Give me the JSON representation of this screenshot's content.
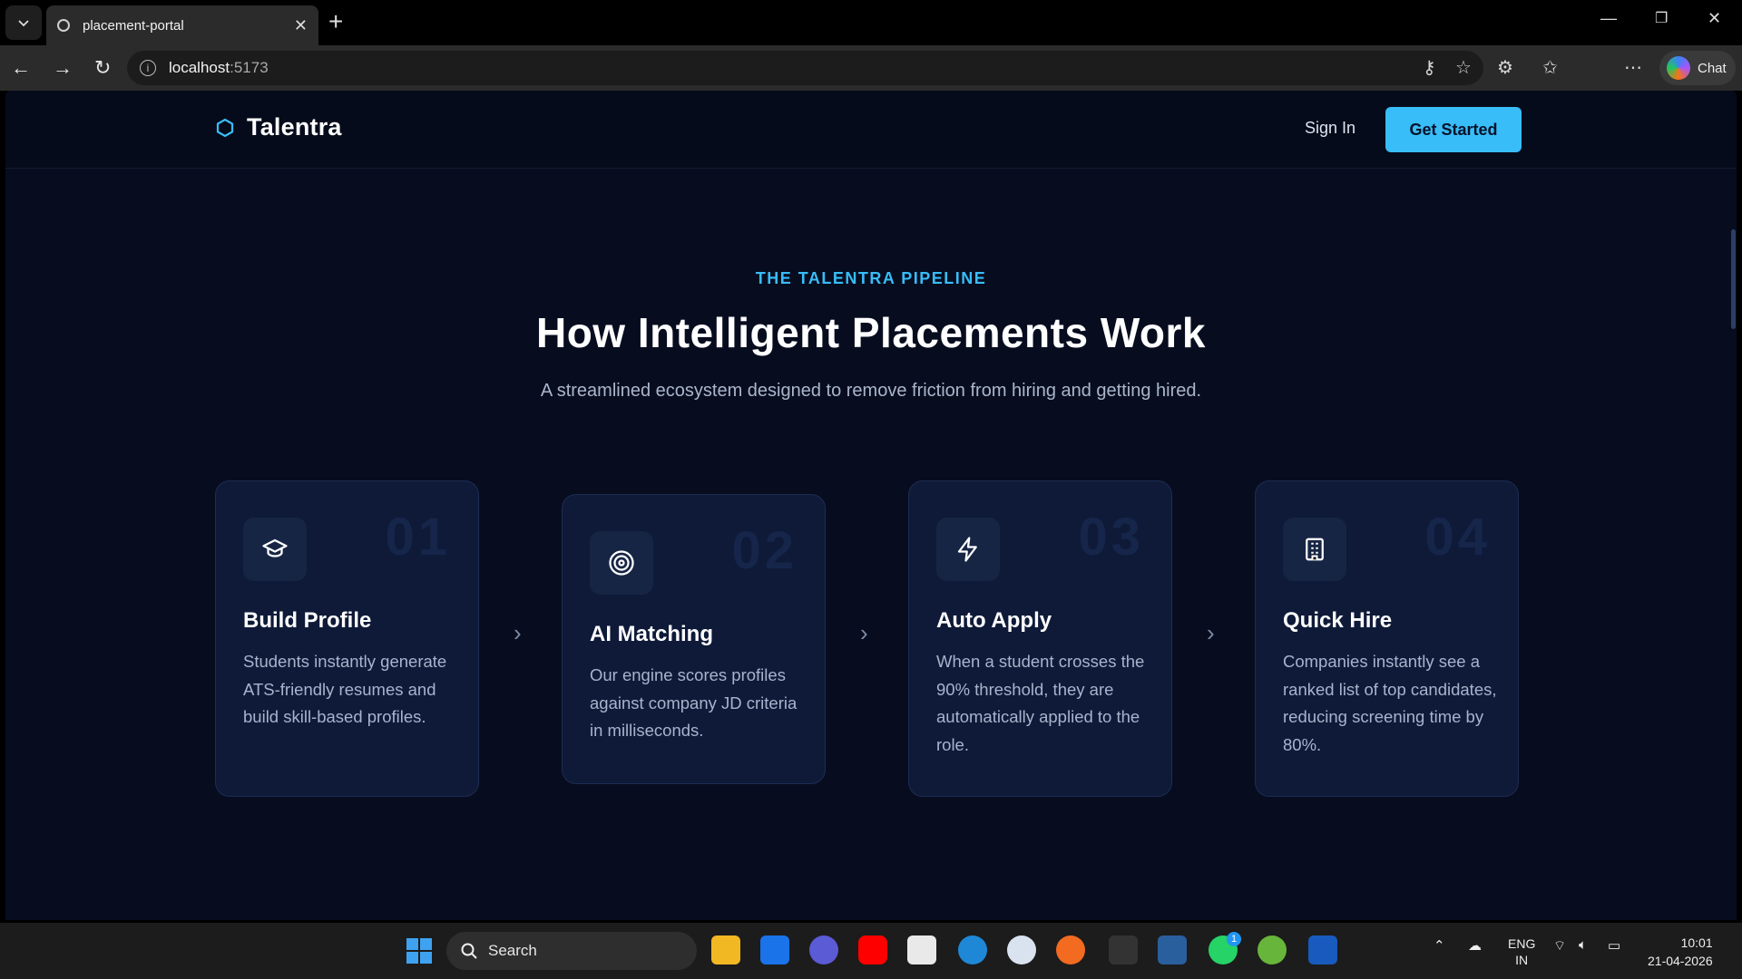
{
  "browser": {
    "tab_title": "placement-portal",
    "url_host": "localhost",
    "url_port": ":5173",
    "chat_label": "Chat"
  },
  "site": {
    "brand": "Talentra",
    "signin_label": "Sign In",
    "cta_label": "Get Started"
  },
  "section": {
    "eyebrow": "THE TALENTRA PIPELINE",
    "title": "How Intelligent Placements Work",
    "subtitle": "A streamlined ecosystem designed to remove friction from hiring and getting hired."
  },
  "steps": [
    {
      "num": "01",
      "icon": "graduation-cap-icon",
      "title": "Build Profile",
      "desc": "Students instantly generate ATS-friendly resumes and build skill-based profiles."
    },
    {
      "num": "02",
      "icon": "target-icon",
      "title": "AI Matching",
      "desc": "Our engine scores profiles against company JD criteria in milliseconds."
    },
    {
      "num": "03",
      "icon": "lightning-icon",
      "title": "Auto Apply",
      "desc": "When a student crosses the 90% threshold, they are automatically applied to the role."
    },
    {
      "num": "04",
      "icon": "building-icon",
      "title": "Quick Hire",
      "desc": "Companies instantly see a ranked list of top candidates, reducing screening time by 80%."
    }
  ],
  "taskbar": {
    "search_label": "Search",
    "lang_line1": "ENG",
    "lang_line2": "IN",
    "time": "10:01",
    "date": "21-04-2026",
    "whatsapp_badge": "1"
  },
  "colors": {
    "accent": "#38bdf8",
    "page_bg": "#070d1f",
    "card_bg": "#0e1a38"
  }
}
